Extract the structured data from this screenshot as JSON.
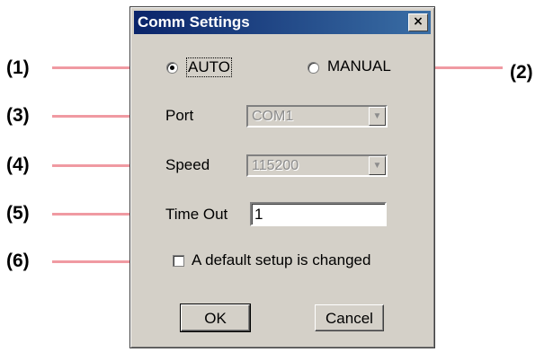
{
  "dialog": {
    "title": "Comm Settings",
    "close_label": "×"
  },
  "callouts": [
    "(1)",
    "(2)",
    "(3)",
    "(4)",
    "(5)",
    "(6)"
  ],
  "mode": {
    "auto_label": "AUTO",
    "manual_label": "MANUAL",
    "selected": "AUTO"
  },
  "port": {
    "label": "Port",
    "value": "COM1",
    "enabled": false
  },
  "speed": {
    "label": "Speed",
    "value": "115200",
    "enabled": false
  },
  "timeout": {
    "label": "Time Out",
    "value": "1"
  },
  "default_setup": {
    "label": "A default setup is changed",
    "checked": false
  },
  "buttons": {
    "ok_label": "OK",
    "cancel_label": "Cancel"
  },
  "colors": {
    "callout_line": "#f09aa2",
    "title_bar": "#0a246a",
    "dialog_face": "#d4d0c8"
  }
}
